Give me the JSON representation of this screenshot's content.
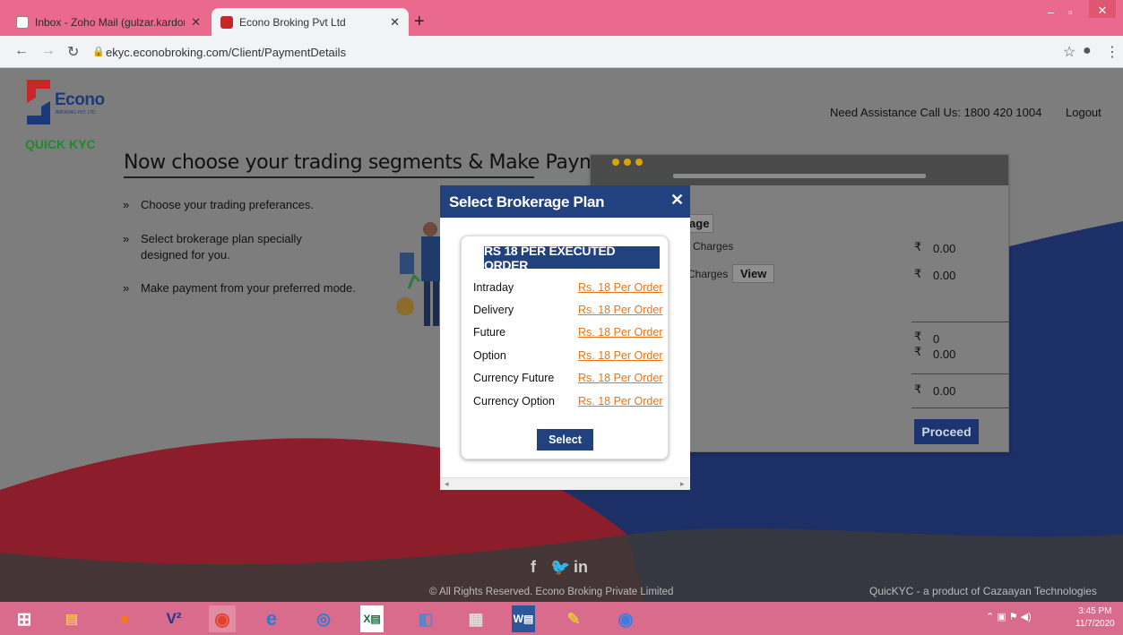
{
  "browser": {
    "tabs": [
      {
        "title": "Inbox - Zoho Mail (gulzar.kardon",
        "active": false
      },
      {
        "title": "Econo Broking Pvt Ltd",
        "active": true
      }
    ],
    "url": "ekyc.econobroking.com/Client/PaymentDetails"
  },
  "header": {
    "logo_name": "Econo",
    "logo_sub": "BROKING PVT LTD",
    "logo_tag": "QUICK KYC",
    "assistance": "Need Assistance Call Us: 1800 420 1004",
    "logout": "Logout"
  },
  "main": {
    "heading": "Now choose your trading segments & Make Payment",
    "steps": [
      "Choose your trading preferances.",
      "Select brokerage plan specially designed for you.",
      "Make payment from your preferred mode."
    ]
  },
  "background_card": {
    "brokerage_btn": "rage",
    "row1_label": "g Charges",
    "row1_value": "0.00",
    "row2_label": "Charges",
    "view_btn": "View",
    "row2_value": "0.00",
    "sum1": "0",
    "sum2": "0.00",
    "total": "0.00",
    "proceed": "Proceed",
    "currency": "₹"
  },
  "modal": {
    "title": "Select Brokerage Plan",
    "plan_title": "RS 18 PER EXECUTED ORDER",
    "rows": [
      {
        "label": "Intraday",
        "rate": "Rs. 18 Per Order"
      },
      {
        "label": "Delivery",
        "rate": "Rs. 18 Per Order"
      },
      {
        "label": "Future",
        "rate": "Rs. 18 Per Order"
      },
      {
        "label": "Option",
        "rate": "Rs. 18 Per Order"
      },
      {
        "label": "Currency Future",
        "rate": "Rs. 18 Per Order"
      },
      {
        "label": "Currency Option",
        "rate": "Rs. 18 Per Order"
      }
    ],
    "select": "Select"
  },
  "footer": {
    "social": [
      "f",
      "in"
    ],
    "copyright": "© All Rights Reserved. Econo Broking Private Limited",
    "product": "QuicKYC - a product of Cazaayan Technologies"
  },
  "taskbar": {
    "time": "3:45 PM",
    "date": "11/7/2020"
  },
  "colors": {
    "tabbar": "#ea6a8e",
    "navy": "#21417f",
    "orange_link": "#e8751a",
    "wave_red": "#8b1e2a",
    "wave_navy": "#1c2f66"
  }
}
